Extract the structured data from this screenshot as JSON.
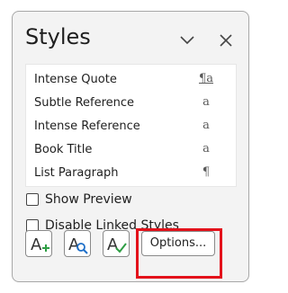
{
  "pane": {
    "title": "Styles",
    "collapse_icon": "chevron-down-icon",
    "close_icon": "close-icon"
  },
  "styles": [
    {
      "label": "Intense Quote",
      "type_glyph": "¶a"
    },
    {
      "label": "Subtle Reference",
      "type_glyph": "a"
    },
    {
      "label": "Intense Reference",
      "type_glyph": "a"
    },
    {
      "label": "Book Title",
      "type_glyph": "a"
    },
    {
      "label": "List Paragraph",
      "type_glyph": "¶"
    }
  ],
  "options": {
    "show_preview": {
      "label": "Show Preview",
      "checked": false
    },
    "disable_linked": {
      "label": "Disable Linked Styles",
      "checked": false
    }
  },
  "toolbar": {
    "new_style_icon": "new-style-icon",
    "style_inspector_icon": "style-inspector-icon",
    "manage_styles_icon": "manage-styles-icon",
    "options_label": "Options..."
  },
  "colors": {
    "highlight": "#e3121b",
    "accent_green": "#2e9e44",
    "accent_blue": "#1e6fc8"
  }
}
